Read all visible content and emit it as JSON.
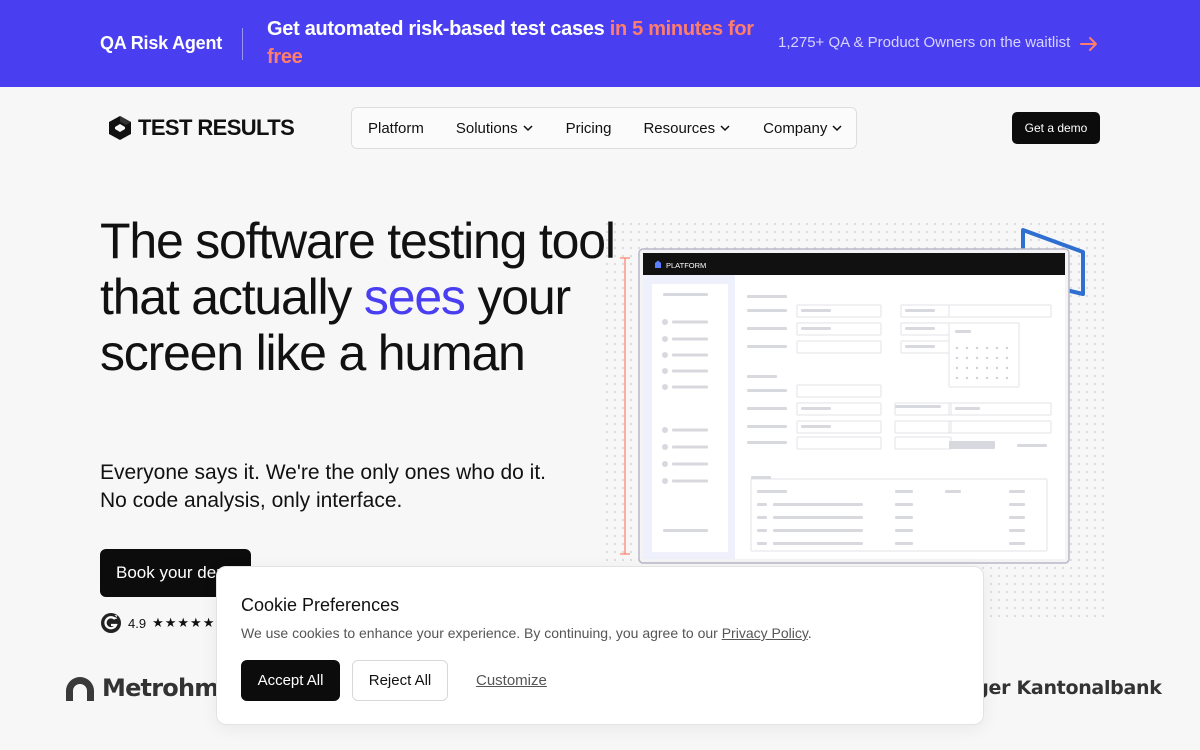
{
  "banner": {
    "agent": "QA Risk Agent",
    "headline_main": "Get automated risk-based test cases ",
    "headline_highlight": "in 5 minutes for free",
    "waitlist": "1,275+ QA & Product Owners on the waitlist",
    "arrow_icon": "arrow-right-icon",
    "highlight_color": "#ff7d6b",
    "bg_color": "#4a3ff0"
  },
  "header": {
    "logo_text": "TEST RESULTS",
    "nav": [
      {
        "label": "Platform",
        "dropdown": false
      },
      {
        "label": "Solutions",
        "dropdown": true
      },
      {
        "label": "Pricing",
        "dropdown": false
      },
      {
        "label": "Resources",
        "dropdown": true
      },
      {
        "label": "Company",
        "dropdown": true
      }
    ],
    "demo_label": "Get a demo"
  },
  "hero": {
    "title_part1": "The software testing tool that actually ",
    "title_accent": "sees",
    "title_part2": " your screen like a human",
    "subtitle_line1": "Everyone says it. We're the only ones who do it.",
    "subtitle_line2": "No code analysis, only interface.",
    "cta_label": "Book your demo",
    "rating_value": "4.9",
    "stars": "★★★★★",
    "accent_color": "#4a3ff0"
  },
  "illustration": {
    "platform_label": "PLATFORM"
  },
  "logos": {
    "metrohm": "Metrohm",
    "kantonalbank": "uger Kantonalbank"
  },
  "cookie": {
    "title": "Cookie Preferences",
    "text": "We use cookies to enhance your experience. By continuing, you agree to our ",
    "link": "Privacy Policy",
    "text_end": ".",
    "accept": "Accept All",
    "reject": "Reject All",
    "customize": "Customize"
  }
}
